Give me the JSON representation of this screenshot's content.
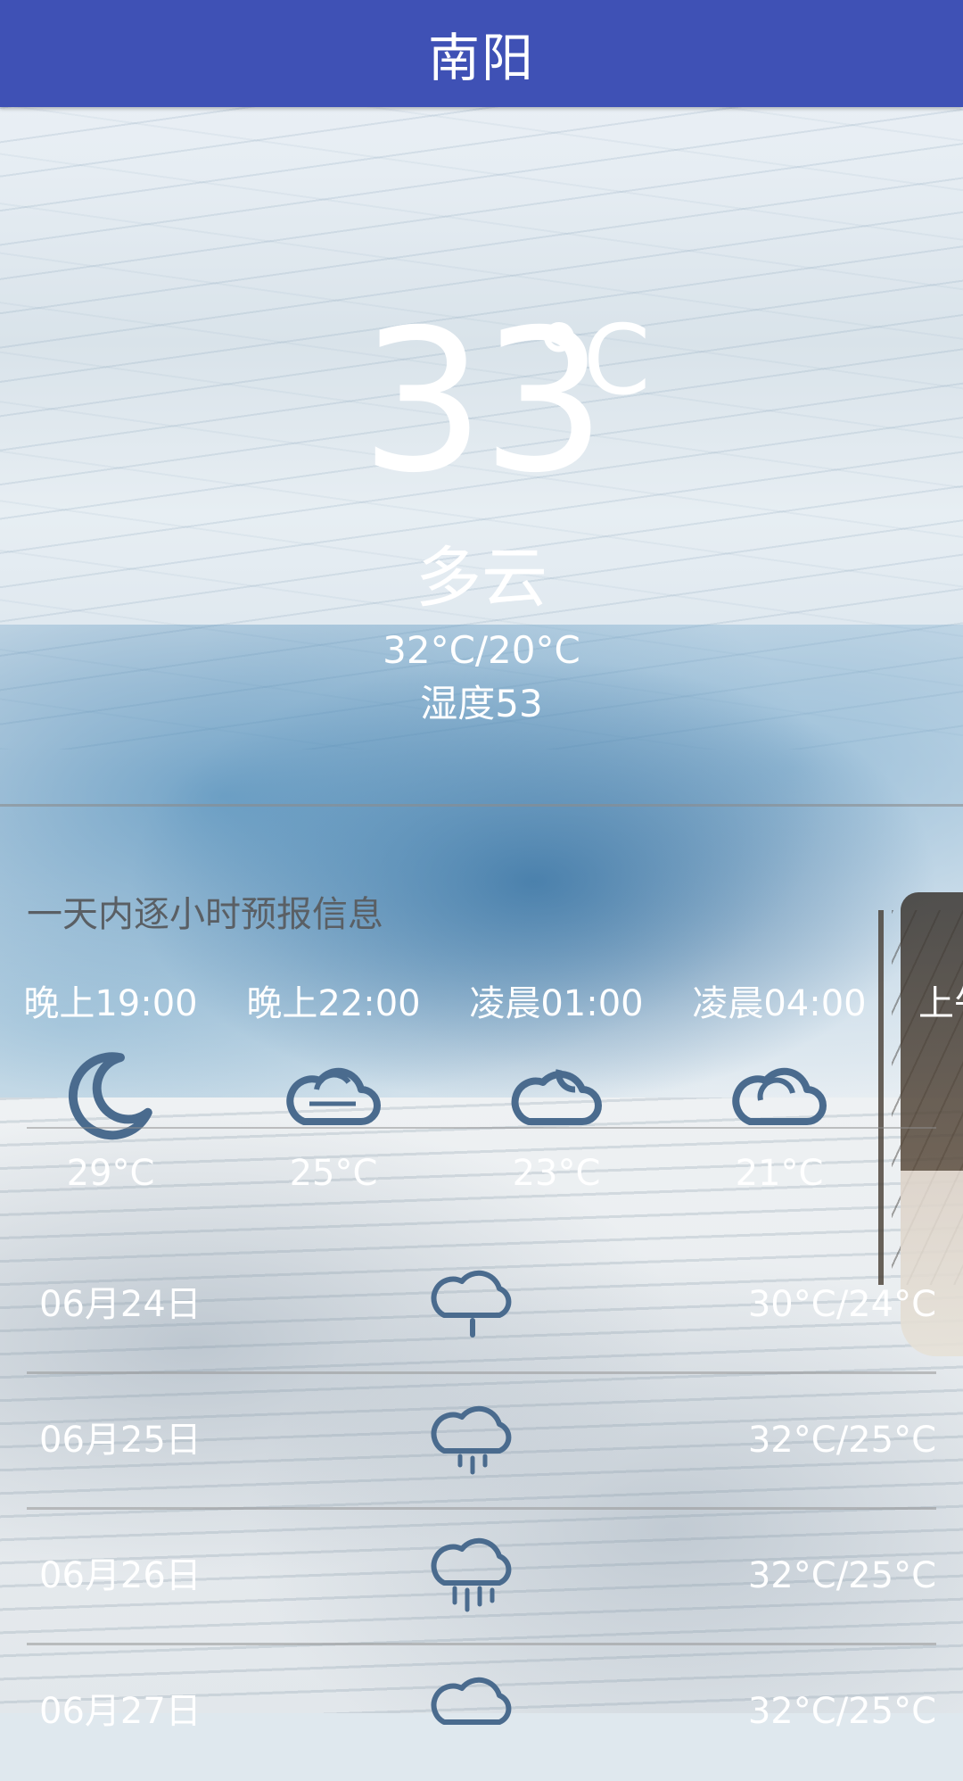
{
  "app": {
    "city": "南阳"
  },
  "now": {
    "temperature": "33",
    "unit": "°C",
    "condition": "多云",
    "range": "32°C/20°C",
    "humidity": "湿度53"
  },
  "hourly": {
    "title": "一天内逐小时预报信息",
    "items": [
      {
        "time": "晚上19:00",
        "icon": "moon-icon",
        "temp": "29°C"
      },
      {
        "time": "晚上22:00",
        "icon": "cloud-icon",
        "temp": "25°C"
      },
      {
        "time": "凌晨01:00",
        "icon": "cloud-night-icon",
        "temp": "23°C"
      },
      {
        "time": "凌晨04:00",
        "icon": "cloud-icon",
        "temp": "21°C"
      },
      {
        "time": "上午",
        "icon": "cloud-icon",
        "temp": ""
      }
    ]
  },
  "daily": [
    {
      "date": "06月24日",
      "icon": "rain-light-icon",
      "range": "30°C/24°C"
    },
    {
      "date": "06月25日",
      "icon": "rain-light-icon",
      "range": "32°C/25°C"
    },
    {
      "date": "06月26日",
      "icon": "rain-heavy-icon",
      "range": "32°C/25°C"
    },
    {
      "date": "06月27日",
      "icon": "rain-light-icon",
      "range": "32°C/25°C"
    }
  ],
  "colors": {
    "appbar": "#3f51b5",
    "icon_stroke": "#4a6b8e",
    "text": "#ffffff"
  }
}
